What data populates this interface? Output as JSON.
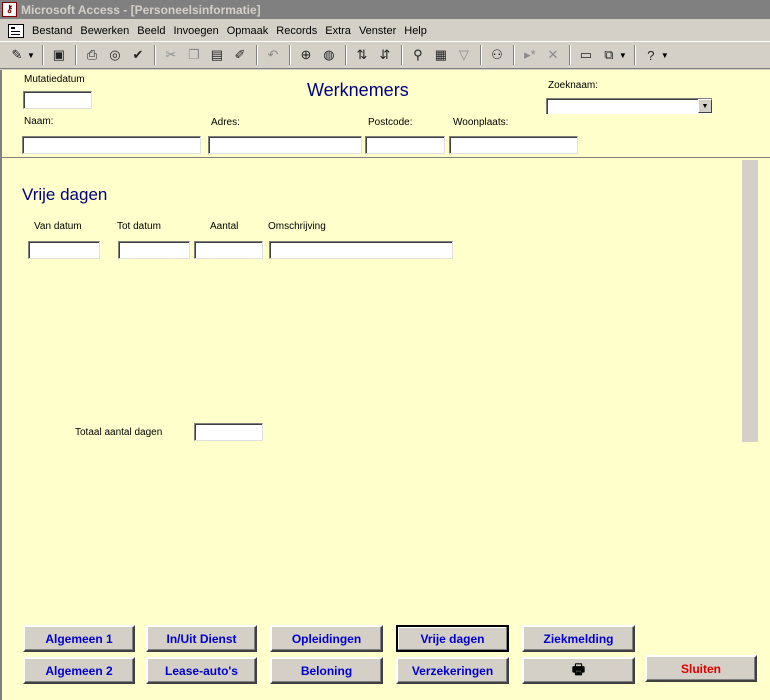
{
  "window": {
    "title": "Microsoft Access - [Personeelsinformatie]",
    "icon": "access-key-icon"
  },
  "menu": [
    "Bestand",
    "Bewerken",
    "Beeld",
    "Invoegen",
    "Opmaak",
    "Records",
    "Extra",
    "Venster",
    "Help"
  ],
  "form": {
    "title": "Werknemers",
    "mutatiedatum_label": "Mutatiedatum",
    "mutatiedatum_value": "",
    "zoeknaam_label": "Zoeknaam:",
    "zoeknaam_value": "",
    "naam_label": "Naam:",
    "naam_value": "",
    "adres_label": "Adres:",
    "adres_value": "",
    "postcode_label": "Postcode:",
    "postcode_value": "",
    "woonplaats_label": "Woonplaats:",
    "woonplaats_value": ""
  },
  "subform": {
    "title": "Vrije dagen",
    "columns": [
      "Van datum",
      "Tot datum",
      "Aantal",
      "Omschrijving"
    ],
    "row": {
      "van": "",
      "tot": "",
      "aantal": "",
      "omschrijving": ""
    },
    "totaal_label": "Totaal aantal dagen",
    "totaal_value": ""
  },
  "buttons": {
    "algemeen1": "Algemeen 1",
    "inuit": "In/Uit Dienst",
    "opleidingen": "Opleidingen",
    "vrijedagen": "Vrije dagen",
    "ziekmelding": "Ziekmelding",
    "algemeen2": "Algemeen 2",
    "lease": "Lease-auto's",
    "beloning": "Beloning",
    "verzekeringen": "Verzekeringen",
    "print": "🖶",
    "sluiten": "Sluiten"
  },
  "colors": {
    "form_bg": "#ffffcc",
    "title": "#000080",
    "button_text": "#0000cc",
    "close_text": "#e00000"
  }
}
